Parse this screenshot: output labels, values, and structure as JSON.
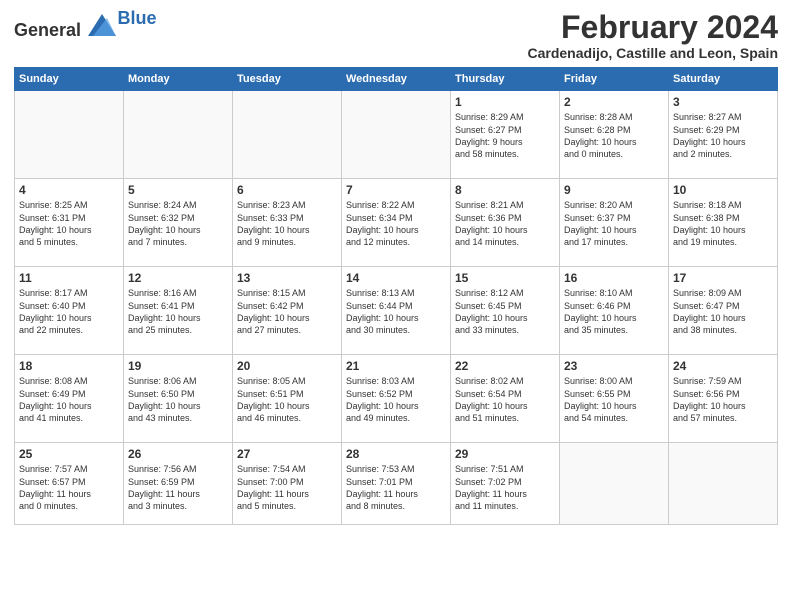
{
  "logo": {
    "general": "General",
    "blue": "Blue"
  },
  "title": "February 2024",
  "location": "Cardenadijo, Castille and Leon, Spain",
  "weekdays": [
    "Sunday",
    "Monday",
    "Tuesday",
    "Wednesday",
    "Thursday",
    "Friday",
    "Saturday"
  ],
  "weeks": [
    [
      {
        "day": "",
        "info": ""
      },
      {
        "day": "",
        "info": ""
      },
      {
        "day": "",
        "info": ""
      },
      {
        "day": "",
        "info": ""
      },
      {
        "day": "1",
        "info": "Sunrise: 8:29 AM\nSunset: 6:27 PM\nDaylight: 9 hours\nand 58 minutes."
      },
      {
        "day": "2",
        "info": "Sunrise: 8:28 AM\nSunset: 6:28 PM\nDaylight: 10 hours\nand 0 minutes."
      },
      {
        "day": "3",
        "info": "Sunrise: 8:27 AM\nSunset: 6:29 PM\nDaylight: 10 hours\nand 2 minutes."
      }
    ],
    [
      {
        "day": "4",
        "info": "Sunrise: 8:25 AM\nSunset: 6:31 PM\nDaylight: 10 hours\nand 5 minutes."
      },
      {
        "day": "5",
        "info": "Sunrise: 8:24 AM\nSunset: 6:32 PM\nDaylight: 10 hours\nand 7 minutes."
      },
      {
        "day": "6",
        "info": "Sunrise: 8:23 AM\nSunset: 6:33 PM\nDaylight: 10 hours\nand 9 minutes."
      },
      {
        "day": "7",
        "info": "Sunrise: 8:22 AM\nSunset: 6:34 PM\nDaylight: 10 hours\nand 12 minutes."
      },
      {
        "day": "8",
        "info": "Sunrise: 8:21 AM\nSunset: 6:36 PM\nDaylight: 10 hours\nand 14 minutes."
      },
      {
        "day": "9",
        "info": "Sunrise: 8:20 AM\nSunset: 6:37 PM\nDaylight: 10 hours\nand 17 minutes."
      },
      {
        "day": "10",
        "info": "Sunrise: 8:18 AM\nSunset: 6:38 PM\nDaylight: 10 hours\nand 19 minutes."
      }
    ],
    [
      {
        "day": "11",
        "info": "Sunrise: 8:17 AM\nSunset: 6:40 PM\nDaylight: 10 hours\nand 22 minutes."
      },
      {
        "day": "12",
        "info": "Sunrise: 8:16 AM\nSunset: 6:41 PM\nDaylight: 10 hours\nand 25 minutes."
      },
      {
        "day": "13",
        "info": "Sunrise: 8:15 AM\nSunset: 6:42 PM\nDaylight: 10 hours\nand 27 minutes."
      },
      {
        "day": "14",
        "info": "Sunrise: 8:13 AM\nSunset: 6:44 PM\nDaylight: 10 hours\nand 30 minutes."
      },
      {
        "day": "15",
        "info": "Sunrise: 8:12 AM\nSunset: 6:45 PM\nDaylight: 10 hours\nand 33 minutes."
      },
      {
        "day": "16",
        "info": "Sunrise: 8:10 AM\nSunset: 6:46 PM\nDaylight: 10 hours\nand 35 minutes."
      },
      {
        "day": "17",
        "info": "Sunrise: 8:09 AM\nSunset: 6:47 PM\nDaylight: 10 hours\nand 38 minutes."
      }
    ],
    [
      {
        "day": "18",
        "info": "Sunrise: 8:08 AM\nSunset: 6:49 PM\nDaylight: 10 hours\nand 41 minutes."
      },
      {
        "day": "19",
        "info": "Sunrise: 8:06 AM\nSunset: 6:50 PM\nDaylight: 10 hours\nand 43 minutes."
      },
      {
        "day": "20",
        "info": "Sunrise: 8:05 AM\nSunset: 6:51 PM\nDaylight: 10 hours\nand 46 minutes."
      },
      {
        "day": "21",
        "info": "Sunrise: 8:03 AM\nSunset: 6:52 PM\nDaylight: 10 hours\nand 49 minutes."
      },
      {
        "day": "22",
        "info": "Sunrise: 8:02 AM\nSunset: 6:54 PM\nDaylight: 10 hours\nand 51 minutes."
      },
      {
        "day": "23",
        "info": "Sunrise: 8:00 AM\nSunset: 6:55 PM\nDaylight: 10 hours\nand 54 minutes."
      },
      {
        "day": "24",
        "info": "Sunrise: 7:59 AM\nSunset: 6:56 PM\nDaylight: 10 hours\nand 57 minutes."
      }
    ],
    [
      {
        "day": "25",
        "info": "Sunrise: 7:57 AM\nSunset: 6:57 PM\nDaylight: 11 hours\nand 0 minutes."
      },
      {
        "day": "26",
        "info": "Sunrise: 7:56 AM\nSunset: 6:59 PM\nDaylight: 11 hours\nand 3 minutes."
      },
      {
        "day": "27",
        "info": "Sunrise: 7:54 AM\nSunset: 7:00 PM\nDaylight: 11 hours\nand 5 minutes."
      },
      {
        "day": "28",
        "info": "Sunrise: 7:53 AM\nSunset: 7:01 PM\nDaylight: 11 hours\nand 8 minutes."
      },
      {
        "day": "29",
        "info": "Sunrise: 7:51 AM\nSunset: 7:02 PM\nDaylight: 11 hours\nand 11 minutes."
      },
      {
        "day": "",
        "info": ""
      },
      {
        "day": "",
        "info": ""
      }
    ]
  ]
}
